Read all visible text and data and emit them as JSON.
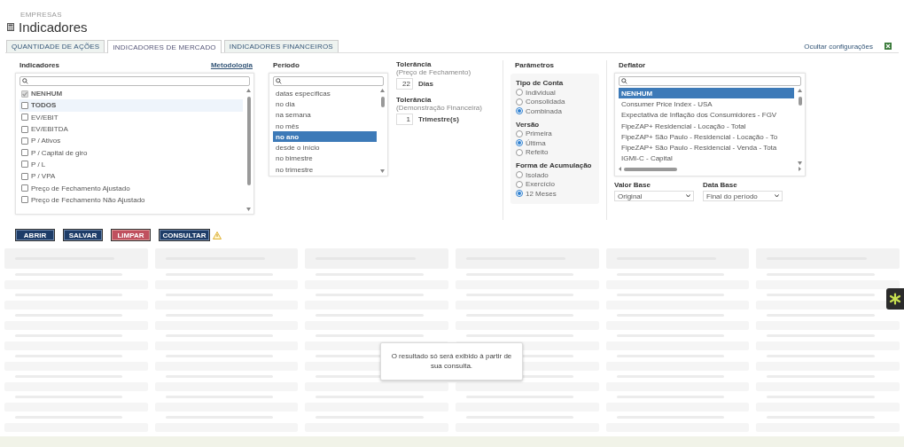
{
  "breadcrumb": "EMPRESAS",
  "title": "Indicadores",
  "tabs": [
    {
      "label": "QUANTIDADE DE AÇÕES",
      "selected": false
    },
    {
      "label": "INDICADORES DE MERCADO",
      "selected": true
    },
    {
      "label": "INDICADORES FINANCEIROS",
      "selected": false
    }
  ],
  "hide_settings_link": "Ocultar configurações",
  "indicators": {
    "title": "Indicadores",
    "link": "Metodologia",
    "items": [
      {
        "label": "NENHUM",
        "kind": "special",
        "checked": true,
        "disabled": true,
        "hovered": false
      },
      {
        "label": "TODOS",
        "kind": "special",
        "checked": false,
        "disabled": false,
        "hovered": true
      },
      {
        "label": "EV/EBIT",
        "kind": "item",
        "checked": false,
        "disabled": false,
        "hovered": false
      },
      {
        "label": "EV/EBITDA",
        "kind": "item",
        "checked": false,
        "disabled": false,
        "hovered": false
      },
      {
        "label": "P / Ativos",
        "kind": "item",
        "checked": false,
        "disabled": false,
        "hovered": false
      },
      {
        "label": "P / Capital de giro",
        "kind": "item",
        "checked": false,
        "disabled": false,
        "hovered": false
      },
      {
        "label": "P / L",
        "kind": "item",
        "checked": false,
        "disabled": false,
        "hovered": false
      },
      {
        "label": "P / VPA",
        "kind": "item",
        "checked": false,
        "disabled": false,
        "hovered": false
      },
      {
        "label": "Preço de Fechamento Ajustado",
        "kind": "item",
        "checked": false,
        "disabled": false,
        "hovered": false
      },
      {
        "label": "Preço de Fechamento Não Ajustado",
        "kind": "item",
        "checked": false,
        "disabled": false,
        "hovered": false
      }
    ]
  },
  "period": {
    "title": "Período",
    "items": [
      {
        "label": "datas específicas",
        "selected": false
      },
      {
        "label": "no dia",
        "selected": false
      },
      {
        "label": "na semana",
        "selected": false
      },
      {
        "label": "no mês",
        "selected": false
      },
      {
        "label": "no ano",
        "selected": true
      },
      {
        "label": "desde o início",
        "selected": false
      },
      {
        "label": "no bimestre",
        "selected": false
      },
      {
        "label": "no trimestre",
        "selected": false
      }
    ]
  },
  "tolerances": [
    {
      "title": "Tolerância",
      "note": "(Preço de Fechamento)",
      "value": "22",
      "unit": "Dias"
    },
    {
      "title": "Tolerância",
      "note": "(Demonstração Financeira)",
      "value": "1",
      "unit": "Trimestre(s)"
    }
  ],
  "parameters": {
    "title": "Parâmetros",
    "groups": [
      {
        "title": "Tipo de Conta",
        "options": [
          {
            "label": "Individual",
            "selected": false
          },
          {
            "label": "Consolidada",
            "selected": false
          },
          {
            "label": "Combinada",
            "selected": true
          }
        ]
      },
      {
        "title": "Versão",
        "options": [
          {
            "label": "Primeira",
            "selected": false
          },
          {
            "label": "Última",
            "selected": true
          },
          {
            "label": "Refeito",
            "selected": false
          }
        ]
      },
      {
        "title": "Forma de Acumulação",
        "options": [
          {
            "label": "Isolado",
            "selected": false
          },
          {
            "label": "Exercício",
            "selected": false
          },
          {
            "label": "12 Meses",
            "selected": true
          }
        ]
      }
    ]
  },
  "deflator": {
    "title": "Deflator",
    "items": [
      {
        "label": "NENHUM",
        "selected": true
      },
      {
        "label": "Consumer Price Index - USA",
        "selected": false
      },
      {
        "label": "Expectativa de Inflação dos Consumidores - FGV",
        "selected": false
      },
      {
        "label": "FipeZAP+ Residencial - Locação - Total",
        "selected": false
      },
      {
        "label": "FipeZAP+ São Paulo - Residencial - Locação - To",
        "selected": false
      },
      {
        "label": "FipeZAP+ São Paulo - Residencial - Venda - Tota",
        "selected": false
      },
      {
        "label": "IGMI-C - Capital",
        "selected": false
      }
    ],
    "selects": [
      {
        "label": "Valor Base",
        "value": "Original"
      },
      {
        "label": "Data Base",
        "value": "Final do período"
      }
    ]
  },
  "buttons": [
    {
      "label": "ABRIR",
      "kind": "primary"
    },
    {
      "label": "SALVAR",
      "kind": "primary"
    },
    {
      "label": "LIMPAR",
      "kind": "danger"
    },
    {
      "label": "CONSULTAR",
      "kind": "primary"
    }
  ],
  "result_message": "O resultado só será exibido à partir de sua consulta."
}
